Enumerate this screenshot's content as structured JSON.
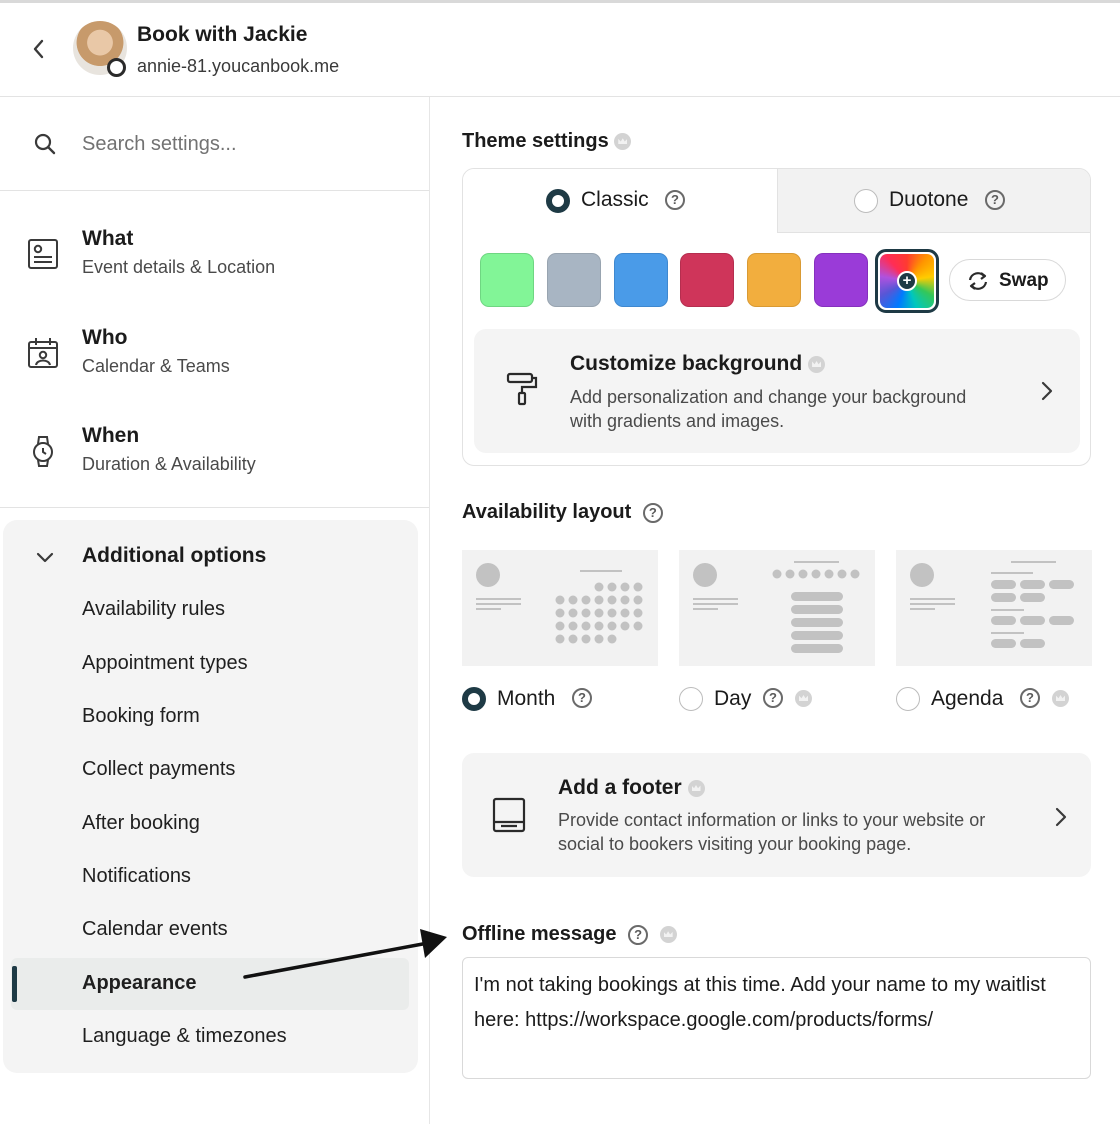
{
  "header": {
    "title": "Book with Jackie",
    "subtitle": "annie-81.youcanbook.me"
  },
  "search": {
    "placeholder": "Search settings..."
  },
  "nav": {
    "main": [
      {
        "title": "What",
        "sub": "Event details & Location",
        "icon": "profile-card-icon"
      },
      {
        "title": "Who",
        "sub": "Calendar & Teams",
        "icon": "calendar-person-icon"
      },
      {
        "title": "When",
        "sub": "Duration & Availability",
        "icon": "watch-icon"
      }
    ],
    "additional": {
      "title": "Additional options",
      "items": [
        "Availability rules",
        "Appointment types",
        "Booking form",
        "Collect payments",
        "After booking",
        "Notifications",
        "Calendar events",
        "Appearance",
        "Language & timezones"
      ],
      "active": "Appearance"
    }
  },
  "theme": {
    "title": "Theme settings",
    "tabs": [
      {
        "label": "Classic",
        "selected": true
      },
      {
        "label": "Duotone",
        "selected": false
      }
    ],
    "swatches": [
      "#82f597",
      "#a8b5c3",
      "#4a9be8",
      "#cf355a",
      "#f2ae3e",
      "#9a3bd8"
    ],
    "swap_label": "Swap",
    "customize": {
      "title": "Customize background",
      "desc": "Add personalization and change your background with gradients and images."
    }
  },
  "availability_layout": {
    "title": "Availability layout",
    "options": [
      {
        "label": "Month",
        "selected": true
      },
      {
        "label": "Day",
        "selected": false
      },
      {
        "label": "Agenda",
        "selected": false
      }
    ]
  },
  "footer_card": {
    "title": "Add a footer",
    "desc": "Provide contact information or links to your website or social to bookers visiting your booking page."
  },
  "offline": {
    "title": "Offline message",
    "value": "I'm not taking bookings at this time. Add your name to my waitlist here: https://workspace.google.com/products/forms/"
  },
  "colors": {
    "accent": "#1e3a45",
    "panel": "#f4f4f4"
  }
}
